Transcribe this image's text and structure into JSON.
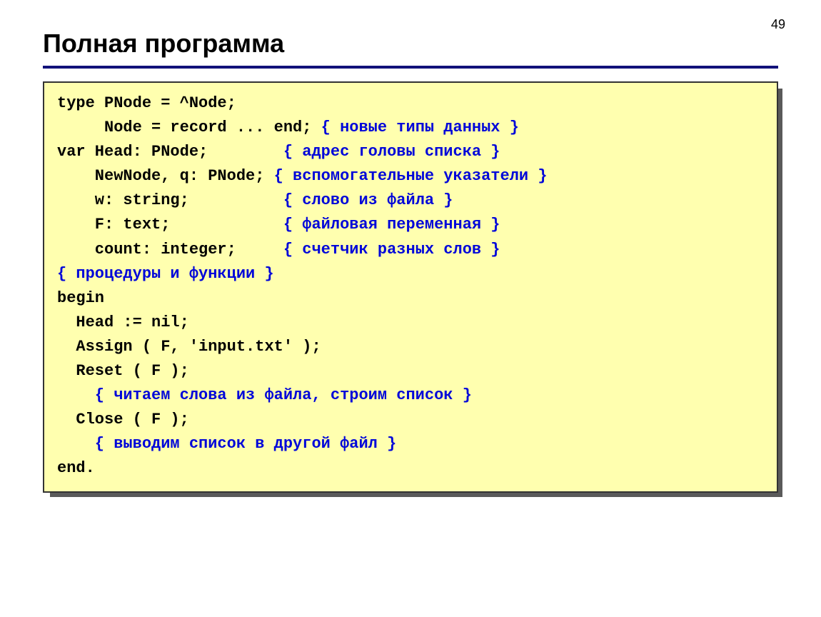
{
  "page_number": "49",
  "title": "Полная программа",
  "code": {
    "l1": "type PNode = ^Node;",
    "l2a": "     Node = record ... end;",
    "l2c": "{ новые типы данных }",
    "l3a": "var Head: PNode;       ",
    "l3c": "{ адрес головы списка }",
    "l4a": "    NewNode, q: PNode;",
    "l4c": "{ вспомогательные указатели }",
    "l5a": "    w: string;         ",
    "l5c": "{ слово из файла }",
    "l6a": "    F: text;           ",
    "l6c": "{ файловая переменная }",
    "l7a": "    count: integer;    ",
    "l7c": "{ счетчик разных слов }",
    "l8c": "{ процедуры и функции }",
    "l9": "begin",
    "l10": "  Head := nil;",
    "l11": "  Assign ( F, 'input.txt' );",
    "l12": "  Reset ( F );",
    "l13c": "    { читаем слова из файла, строим список }",
    "l14": "  Close ( F );",
    "l15c": "    { выводим список в другой файл }",
    "l16": "end."
  }
}
